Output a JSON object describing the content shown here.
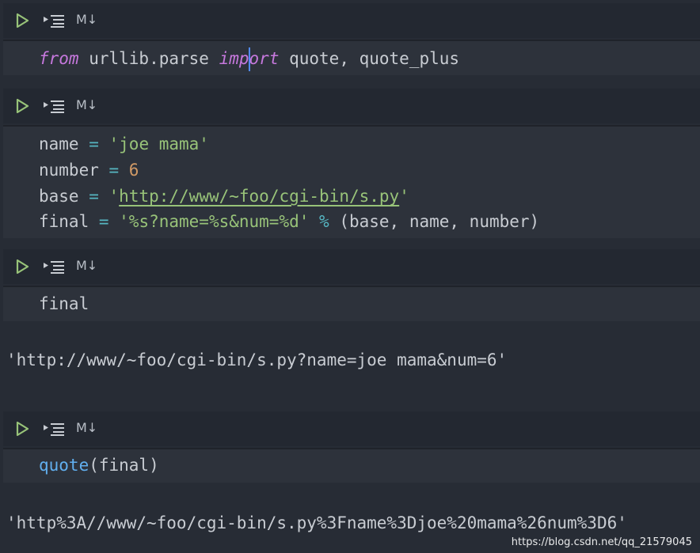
{
  "cells": [
    {
      "toolbar": {
        "md_label": "M↓"
      },
      "lines": [
        {
          "t1": "from",
          "t2": " urllib.parse ",
          "t3a": "imp",
          "t3b": "ort",
          "t4": " quote, quote_plus"
        }
      ]
    },
    {
      "toolbar": {
        "md_label": "M↓"
      },
      "lines": [
        {
          "name": "name",
          "eq": " = ",
          "val": "'joe mama'"
        },
        {
          "name": "number",
          "eq": " = ",
          "val": "6"
        },
        {
          "name": "base",
          "eq": " = ",
          "q1": "'",
          "url": "http://www/~foo/cgi-bin/s.py",
          "q2": "'"
        },
        {
          "name": "final",
          "eq": " = ",
          "val": "'%s?name=%s&num=%d'",
          "op": " % ",
          "rest": "(base, name, number)"
        }
      ]
    },
    {
      "toolbar": {
        "md_label": "M↓"
      },
      "lines": [
        {
          "text": "final"
        }
      ],
      "output": "'http://www/~foo/cgi-bin/s.py?name=joe mama&num=6'"
    },
    {
      "toolbar": {
        "md_label": "M↓"
      },
      "lines": [
        {
          "fn": "quote",
          "rest": "(final)"
        }
      ],
      "output": "'http%3A//www/~foo/cgi-bin/s.py%3Fname%3Djoe%20mama%26num%3D6'"
    }
  ],
  "watermark": "https://blog.csdn.net/qq_21579045",
  "colors": {
    "background": "#272c35",
    "code_bg": "#2d323b",
    "keyword": "#c678dd",
    "string": "#98c379",
    "number": "#d19a66",
    "function": "#61afef",
    "operator": "#56b6c2",
    "run_icon": "#98c379"
  },
  "icons": [
    "run-cell-icon",
    "run-by-line-icon"
  ]
}
